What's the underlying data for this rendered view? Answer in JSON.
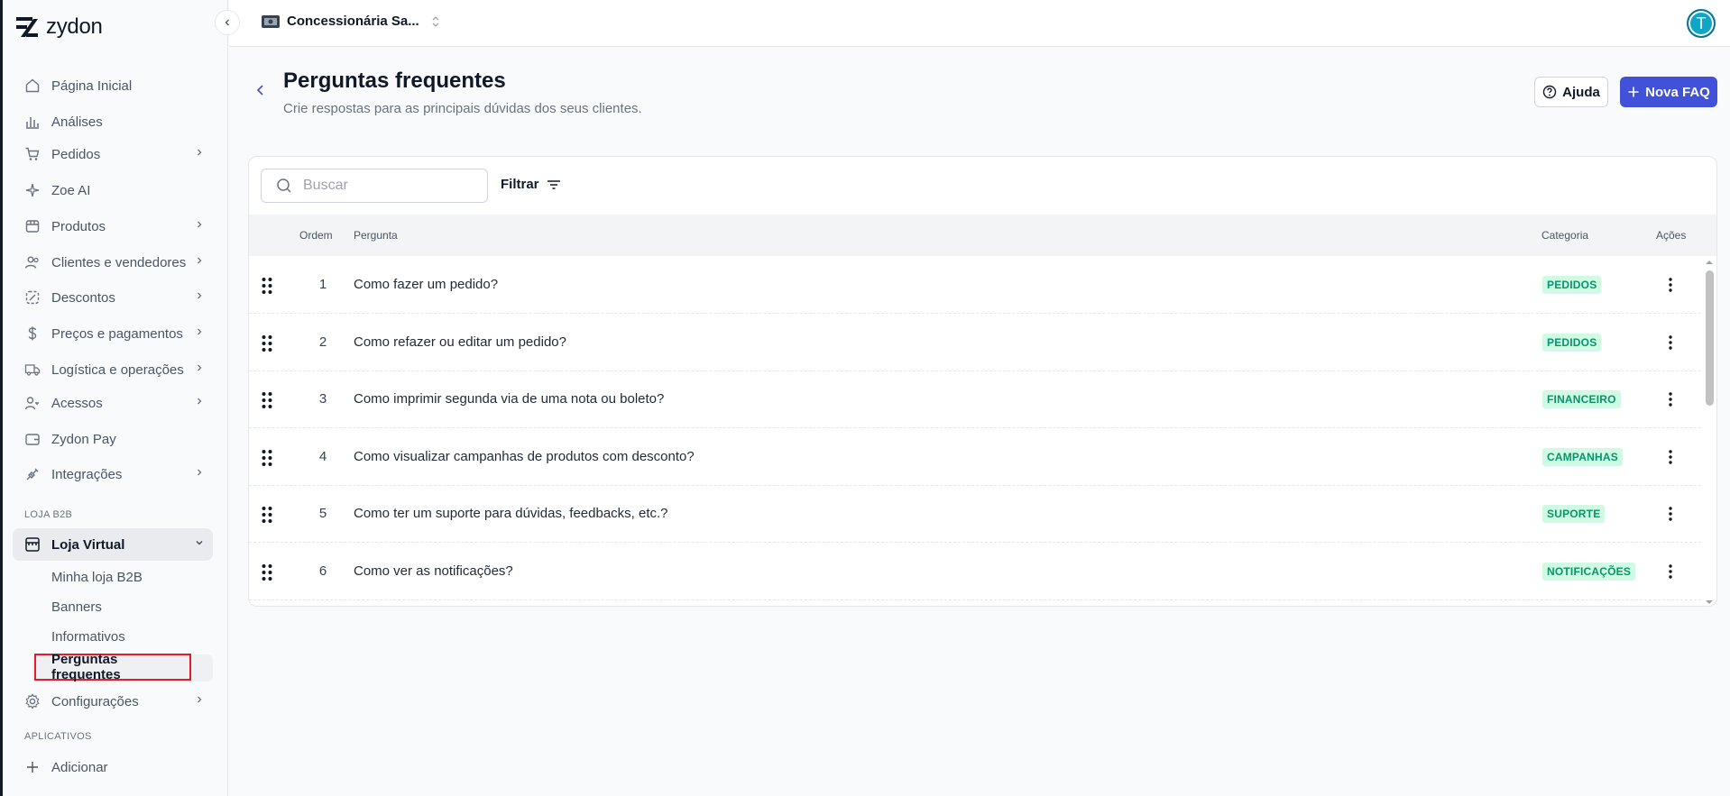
{
  "app": {
    "name": "zydon"
  },
  "sidebar": {
    "items": [
      {
        "label": "Página Inicial",
        "icon": "home-icon",
        "chevron": false
      },
      {
        "label": "Análises",
        "icon": "chart-icon",
        "chevron": false
      },
      {
        "label": "Pedidos",
        "icon": "cart-icon",
        "chevron": true
      },
      {
        "label": "Zoe AI",
        "icon": "sparkle-icon",
        "chevron": false
      },
      {
        "label": "Produtos",
        "icon": "box-icon",
        "chevron": true
      },
      {
        "label": "Clientes e vendedores",
        "icon": "users-icon",
        "chevron": true
      },
      {
        "label": "Descontos",
        "icon": "discount-icon",
        "chevron": true
      },
      {
        "label": "Preços e pagamentos",
        "icon": "dollar-icon",
        "chevron": true
      },
      {
        "label": "Logística e operações",
        "icon": "truck-icon",
        "chevron": true
      },
      {
        "label": "Acessos",
        "icon": "key-users-icon",
        "chevron": true
      },
      {
        "label": "Zydon Pay",
        "icon": "wallet-icon",
        "chevron": false
      },
      {
        "label": "Integrações",
        "icon": "plug-icon",
        "chevron": true
      }
    ],
    "section_b2b": "LOJA B2B",
    "loja_virtual": {
      "label": "Loja Virtual",
      "subitems": [
        "Minha loja B2B",
        "Banners",
        "Informativos",
        "Perguntas frequentes"
      ]
    },
    "configuracoes": "Configurações",
    "section_apps": "APLICATIVOS",
    "add": "Adicionar"
  },
  "topbar": {
    "store_name": "Concessionária Sa...",
    "avatar_initial": "T"
  },
  "header": {
    "title": "Perguntas frequentes",
    "subtitle": "Crie respostas para as principais dúvidas dos seus clientes.",
    "help_label": "Ajuda",
    "new_label": "Nova FAQ"
  },
  "search": {
    "placeholder": "Buscar"
  },
  "filter_label": "Filtrar",
  "table": {
    "headers": {
      "order": "Ordem",
      "question": "Pergunta",
      "category": "Categoria",
      "actions": "Ações"
    },
    "rows": [
      {
        "order": "1",
        "question": "Como fazer um pedido?",
        "category": "PEDIDOS"
      },
      {
        "order": "2",
        "question": "Como refazer ou editar um pedido?",
        "category": "PEDIDOS"
      },
      {
        "order": "3",
        "question": "Como imprimir segunda via de uma nota ou boleto?",
        "category": "FINANCEIRO"
      },
      {
        "order": "4",
        "question": "Como visualizar campanhas de produtos com desconto?",
        "category": "CAMPANHAS"
      },
      {
        "order": "5",
        "question": "Como ter um suporte para dúvidas, feedbacks, etc.?",
        "category": "SUPORTE"
      },
      {
        "order": "6",
        "question": "Como ver as notificações?",
        "category": "NOTIFICAÇÕES"
      }
    ]
  },
  "colors": {
    "primary": "#4152d8",
    "badge_bg": "#d1fae5",
    "badge_text": "#059669",
    "highlight": "#e11d2a"
  }
}
